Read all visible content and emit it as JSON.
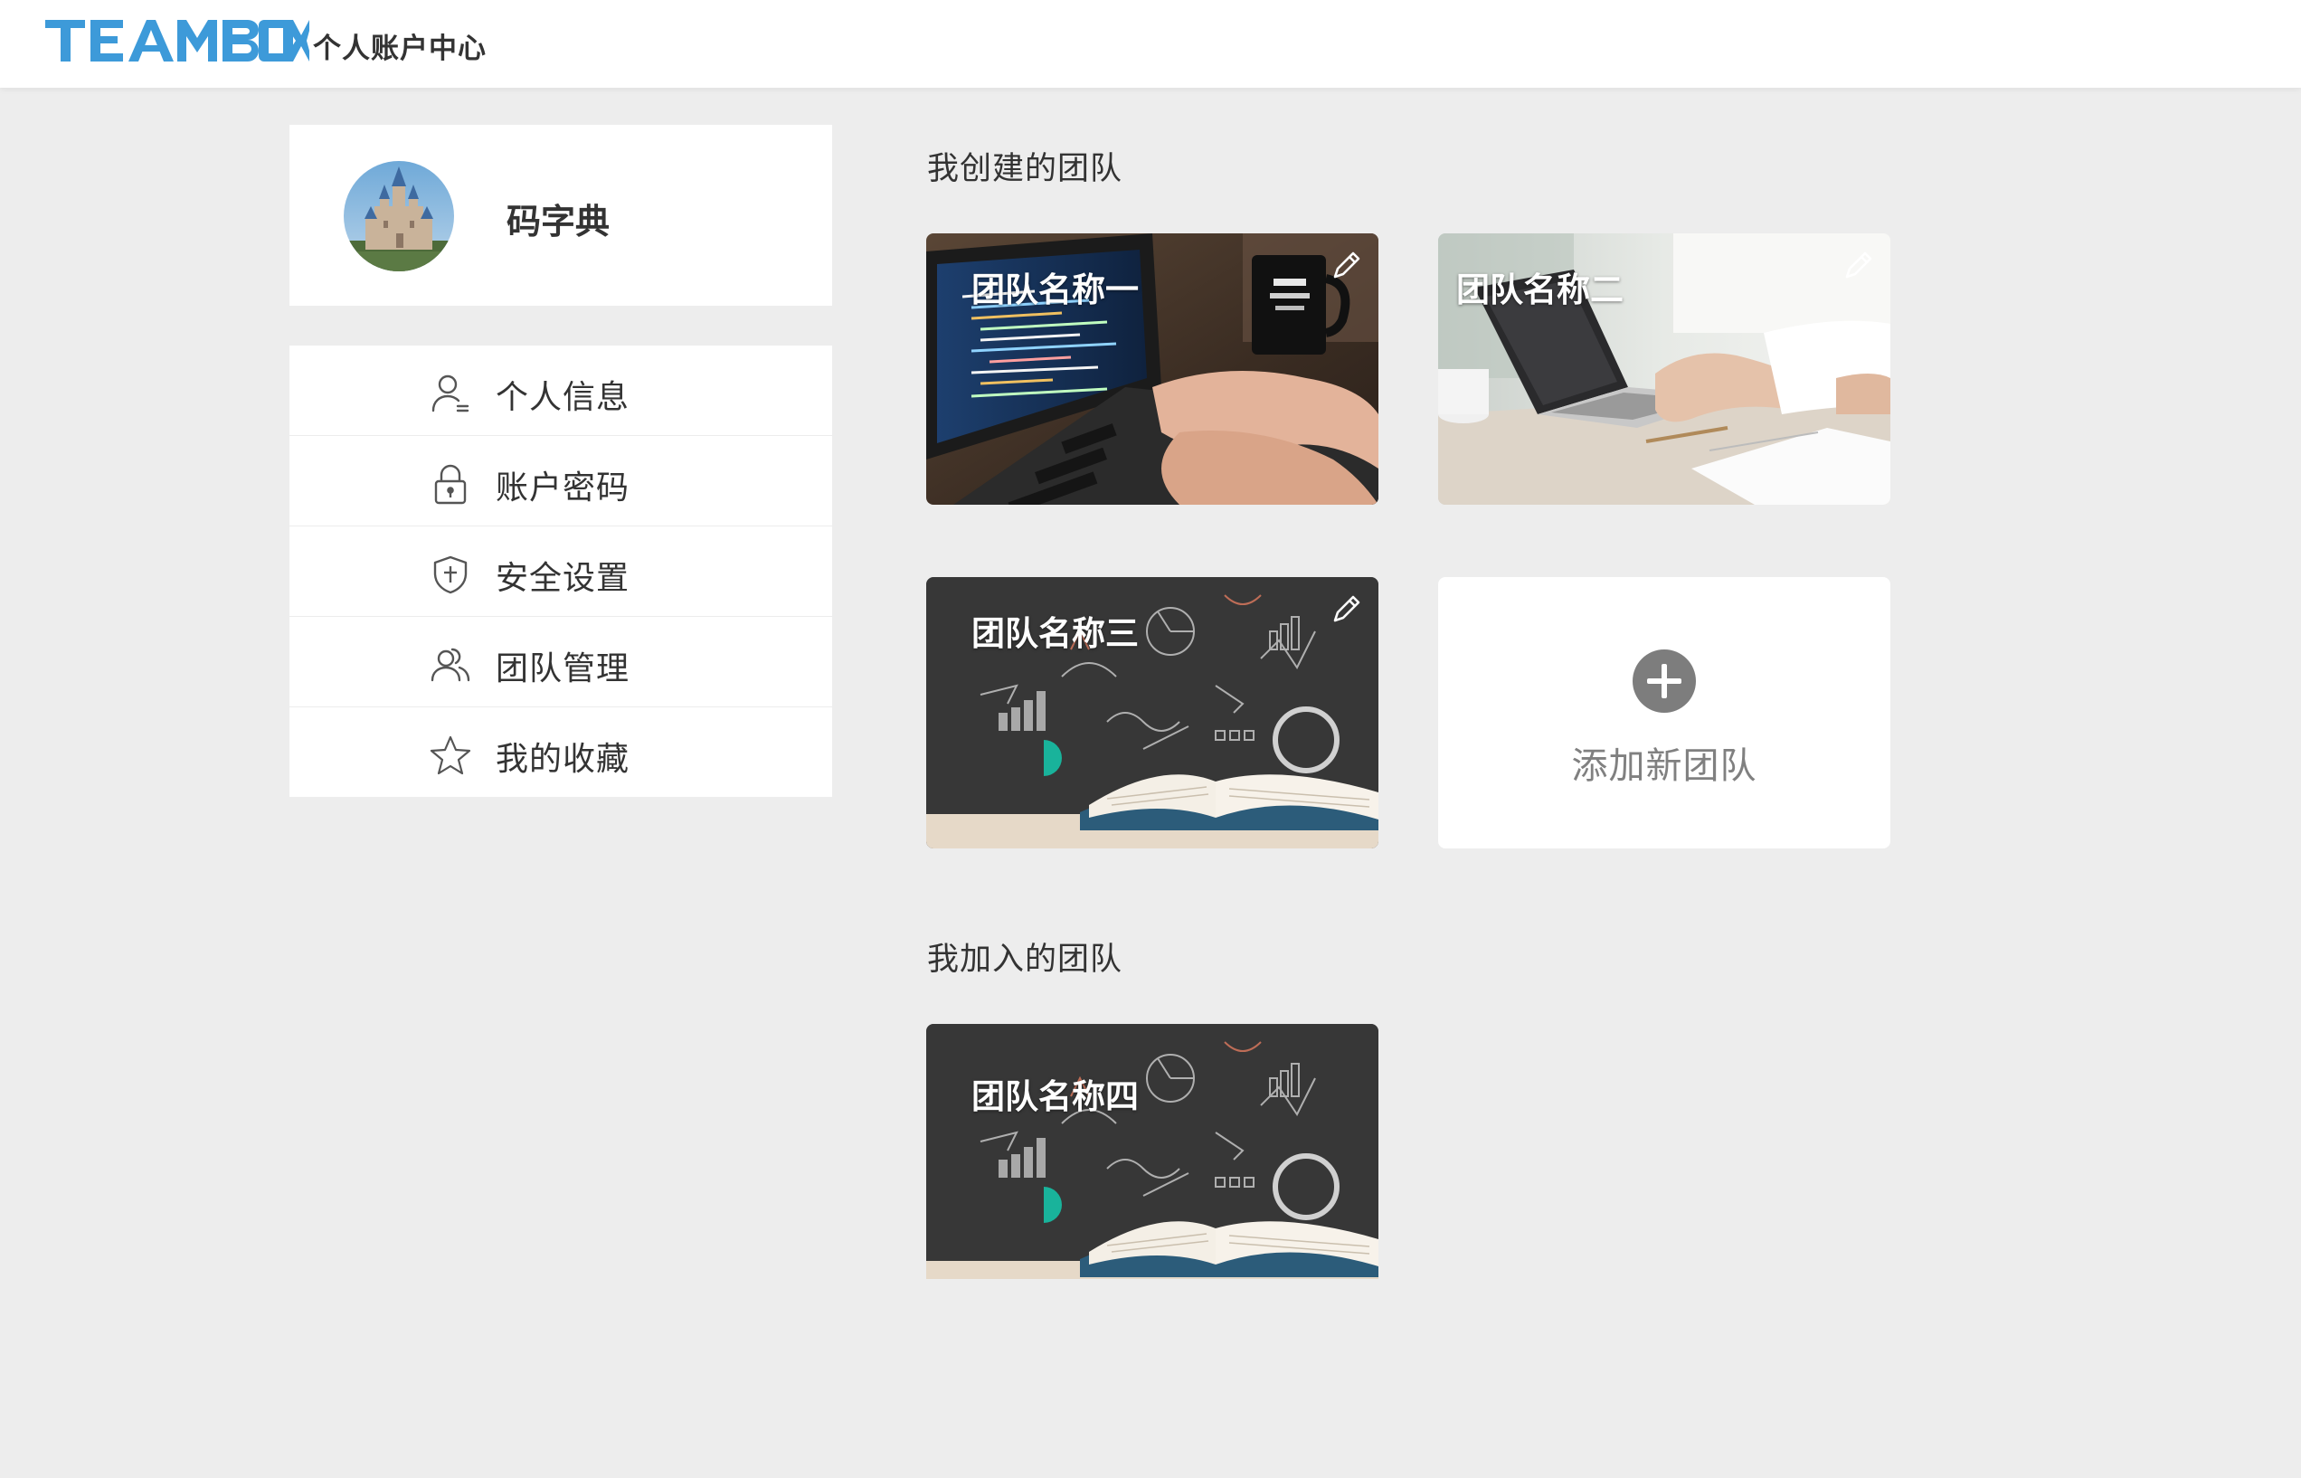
{
  "header": {
    "logo_text": "TEAMBOX",
    "subtitle": "个人账户中心",
    "brand_color": "#3d9ad9"
  },
  "profile": {
    "name": "码字典",
    "avatar_icon": "castle-avatar"
  },
  "menu": {
    "items": [
      {
        "label": "个人信息",
        "icon": "user-icon"
      },
      {
        "label": "账户密码",
        "icon": "lock-icon"
      },
      {
        "label": "安全设置",
        "icon": "shield-icon"
      },
      {
        "label": "团队管理",
        "icon": "team-icon"
      },
      {
        "label": "我的收藏",
        "icon": "star-icon"
      }
    ]
  },
  "created_section": {
    "title": "我创建的团队",
    "teams": [
      {
        "name": "团队名称一",
        "image": "laptop-code-photo",
        "editable": true
      },
      {
        "name": "团队名称二",
        "image": "laptop-desk-photo",
        "editable": true
      },
      {
        "name": "团队名称三",
        "image": "chalkboard-book-photo",
        "editable": true
      }
    ],
    "add_label": "添加新团队"
  },
  "joined_section": {
    "title": "我加入的团队",
    "teams": [
      {
        "name": "团队名称四",
        "image": "chalkboard-book-photo",
        "editable": false
      }
    ]
  }
}
